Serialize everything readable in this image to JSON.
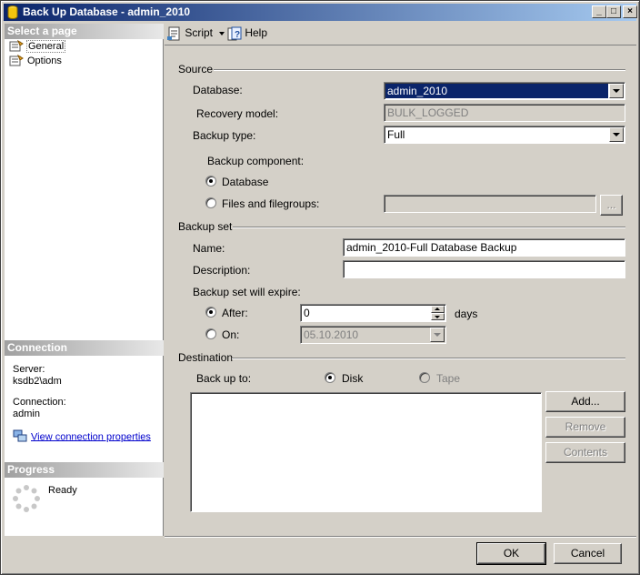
{
  "window": {
    "title": "Back Up Database - admin_2010"
  },
  "titlebar_buttons": {
    "minimize": "_",
    "maximize": "□",
    "close": "×"
  },
  "left": {
    "select_page_header": "Select a page",
    "pages": [
      {
        "label": "General"
      },
      {
        "label": "Options"
      }
    ],
    "connection_header": "Connection",
    "server_label": "Server:",
    "server_value": "ksdb2\\adm",
    "connection_label": "Connection:",
    "connection_value": "admin",
    "view_connection_link": "View connection properties",
    "progress_header": "Progress",
    "progress_status": "Ready"
  },
  "toolbar": {
    "script_label": "Script",
    "help_label": "Help"
  },
  "source": {
    "group_label": "Source",
    "database_label": "Database:",
    "database_value": "admin_2010",
    "recovery_label": "Recovery model:",
    "recovery_value": "BULK_LOGGED",
    "backup_type_label": "Backup type:",
    "backup_type_value": "Full",
    "component_label": "Backup component:",
    "component_database": "Database",
    "component_files": "Files and filegroups:",
    "browse_label": "..."
  },
  "backup_set": {
    "group_label": "Backup set",
    "name_label": "Name:",
    "name_value": "admin_2010-Full Database Backup",
    "description_label": "Description:",
    "description_value": "",
    "expire_label": "Backup set will expire:",
    "after_label": "After:",
    "after_value": "0",
    "days_label": "days",
    "on_label": "On:",
    "on_value": "05.10.2010"
  },
  "destination": {
    "group_label": "Destination",
    "backup_to_label": "Back up to:",
    "disk_label": "Disk",
    "tape_label": "Tape",
    "add_label": "Add...",
    "remove_label": "Remove",
    "contents_label": "Contents"
  },
  "footer": {
    "ok_label": "OK",
    "cancel_label": "Cancel"
  }
}
